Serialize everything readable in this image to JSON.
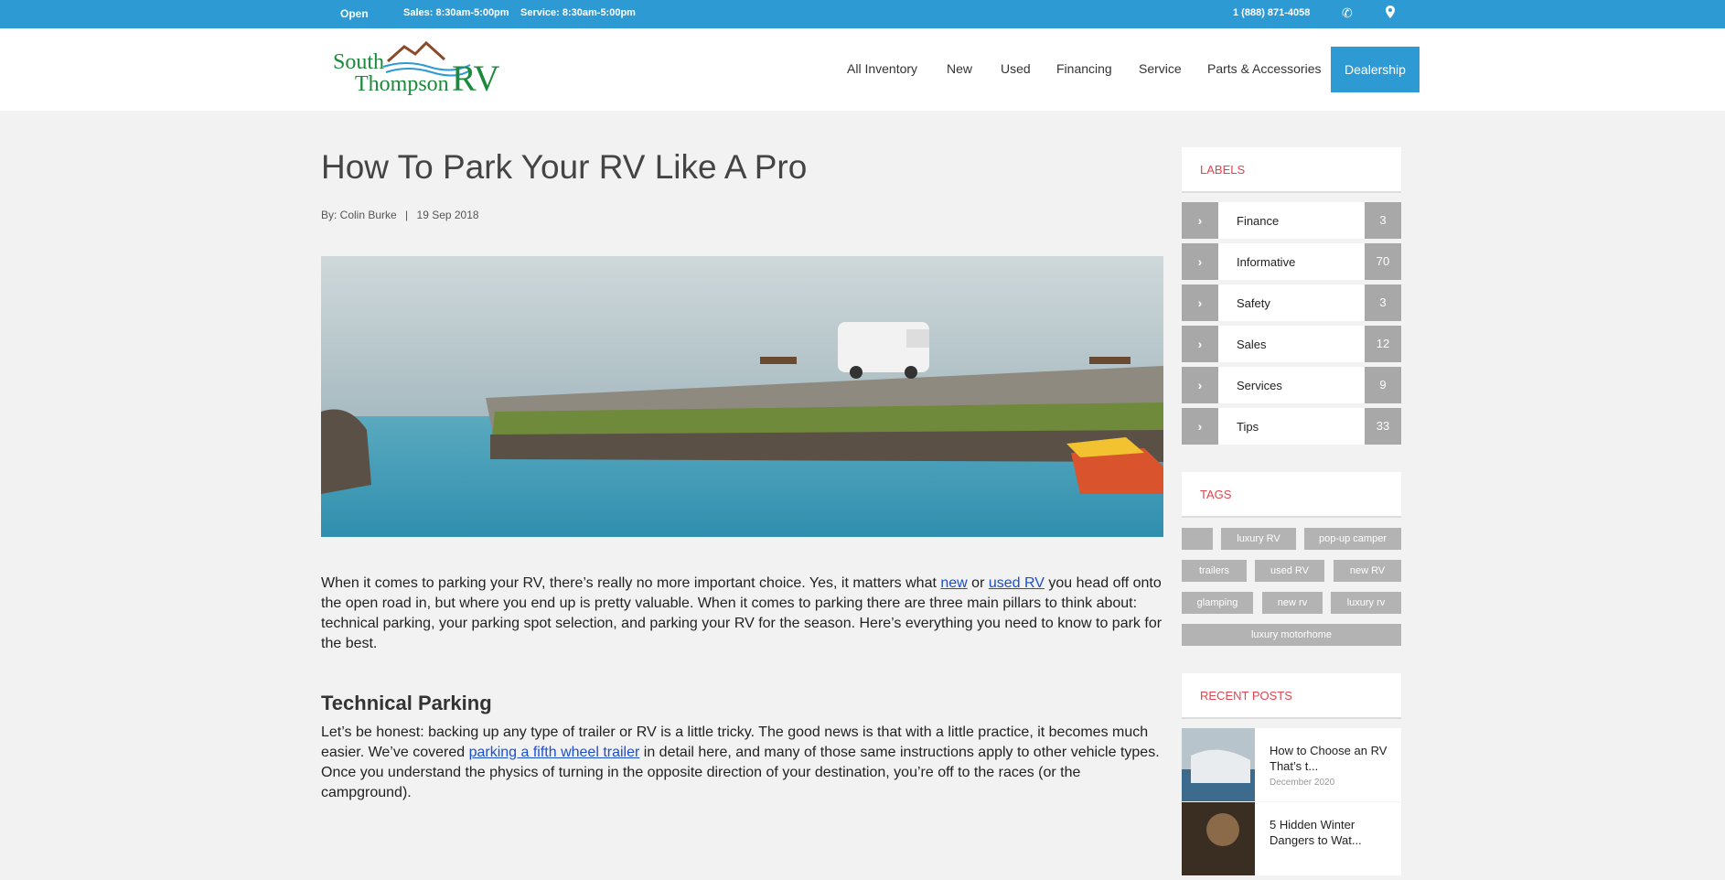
{
  "topbar": {
    "open": "Open",
    "sales": "Sales: 8:30am-5:00pm",
    "service": "Service: 8:30am-5:00pm",
    "phone": "1 (888) 871-4058"
  },
  "logo": {
    "line1": "South",
    "line2": "Thompson",
    "rv": "RV"
  },
  "nav": {
    "all_inventory": "All Inventory",
    "new": "New",
    "used": "Used",
    "financing": "Financing",
    "service": "Service",
    "parts": "Parts & Accessories",
    "dealership": "Dealership"
  },
  "article": {
    "title": "How To Park Your RV Like A Pro",
    "author": "By: Colin Burke",
    "date": "19 Sep 2018",
    "p1_a": "When it comes to parking your RV, there’s really no more important choice. Yes, it matters what ",
    "p1_link1": "new",
    "p1_b": " or ",
    "p1_link2": "used RV",
    "p1_c": " you head off onto the open road in, but where you end up is pretty valuable. When it comes to parking there are three main pillars to think about: technical parking, your parking spot selection, and parking your RV for the season. Here’s everything you need to know to park for the best.",
    "h2": "Technical Parking",
    "p2_a": "Let’s be honest: backing up any type of trailer or RV is a little tricky. The good news is that with a little practice, it becomes much easier. We’ve covered ",
    "p2_link": "parking a fifth wheel trailer",
    "p2_b": " in detail here, and many of those same instructions apply to other vehicle types. Once you understand the physics of turning in the opposite direction of your destination, you’re off to the races (or the campground)."
  },
  "sidebar": {
    "labels_title": "LABELS",
    "labels": [
      {
        "name": "Finance",
        "count": "3"
      },
      {
        "name": "Informative",
        "count": "70"
      },
      {
        "name": "Safety",
        "count": "3"
      },
      {
        "name": "Sales",
        "count": "12"
      },
      {
        "name": "Services",
        "count": "9"
      },
      {
        "name": "Tips",
        "count": "33"
      }
    ],
    "tags_title": "TAGS",
    "tags": [
      "",
      "luxury RV",
      "pop-up camper",
      "trailers",
      "used RV",
      "new RV",
      "glamping",
      "new rv",
      "luxury rv",
      "luxury motorhome"
    ],
    "recent_title": "RECENT POSTS",
    "posts": [
      {
        "title": "How to Choose an RV That’s t...",
        "date": "December 2020"
      },
      {
        "title": "5 Hidden Winter Dangers to Wat...",
        "date": ""
      }
    ]
  },
  "colors": {
    "accent": "#2e9ad3",
    "heading_red": "#e0444f",
    "link": "#1a4fd0"
  }
}
